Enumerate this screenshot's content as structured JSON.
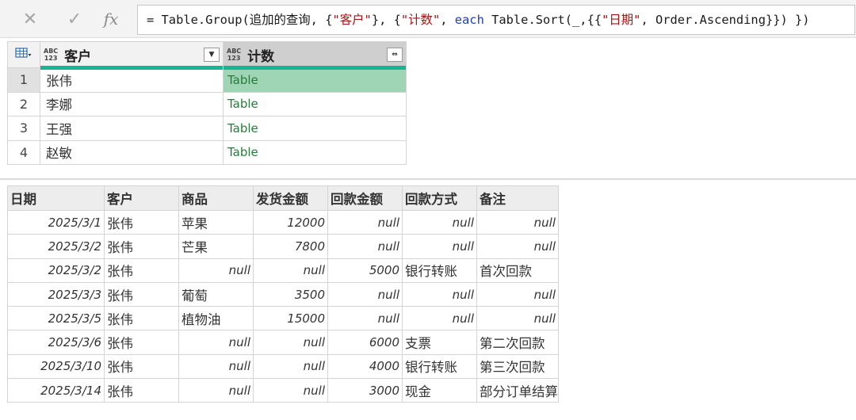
{
  "formula_bar": {
    "cancel_icon": "cross-icon",
    "confirm_icon": "check-icon",
    "fx_label": "fx",
    "formula_prefix": "= Table.Group(追加的查询, {",
    "str1": "\"客户\"",
    "mid1": "}, {",
    "str2": "\"计数\"",
    "mid2": ", ",
    "kw_each": "each",
    "mid3": " Table.Sort(_,{{",
    "str3": "\"日期\"",
    "tail": ", Order.Ascending}})  })"
  },
  "grouped_table": {
    "columns": [
      {
        "type_icon": "ABC\n123",
        "name": "客户",
        "button": "▼"
      },
      {
        "type_icon": "ABC\n123",
        "name": "计数",
        "button": "⇔"
      }
    ],
    "rows": [
      {
        "num": "1",
        "customer": "张伟",
        "count": "Table"
      },
      {
        "num": "2",
        "customer": "李娜",
        "count": "Table"
      },
      {
        "num": "3",
        "customer": "王强",
        "count": "Table"
      },
      {
        "num": "4",
        "customer": "赵敏",
        "count": "Table"
      }
    ],
    "colors": {
      "quality_bar": "#1ab394",
      "selected_cell": "#9fd5b4",
      "table_text": "#2a7a3e"
    }
  },
  "preview_table": {
    "headers": [
      "日期",
      "客户",
      "商品",
      "发货金额",
      "回款金额",
      "回款方式",
      "备注"
    ],
    "rows": [
      [
        "2025/3/1",
        "张伟",
        "苹果",
        "12000",
        "null",
        "null",
        "null"
      ],
      [
        "2025/3/2",
        "张伟",
        "芒果",
        "7800",
        "null",
        "null",
        "null"
      ],
      [
        "2025/3/2",
        "张伟",
        "null",
        "null",
        "5000",
        "银行转账",
        "首次回款"
      ],
      [
        "2025/3/3",
        "张伟",
        "葡萄",
        "3500",
        "null",
        "null",
        "null"
      ],
      [
        "2025/3/5",
        "张伟",
        "植物油",
        "15000",
        "null",
        "null",
        "null"
      ],
      [
        "2025/3/6",
        "张伟",
        "null",
        "null",
        "6000",
        "支票",
        "第二次回款"
      ],
      [
        "2025/3/10",
        "张伟",
        "null",
        "null",
        "4000",
        "银行转账",
        "第三次回款"
      ],
      [
        "2025/3/14",
        "张伟",
        "null",
        "null",
        "3000",
        "现金",
        "部分订单结算"
      ]
    ]
  }
}
